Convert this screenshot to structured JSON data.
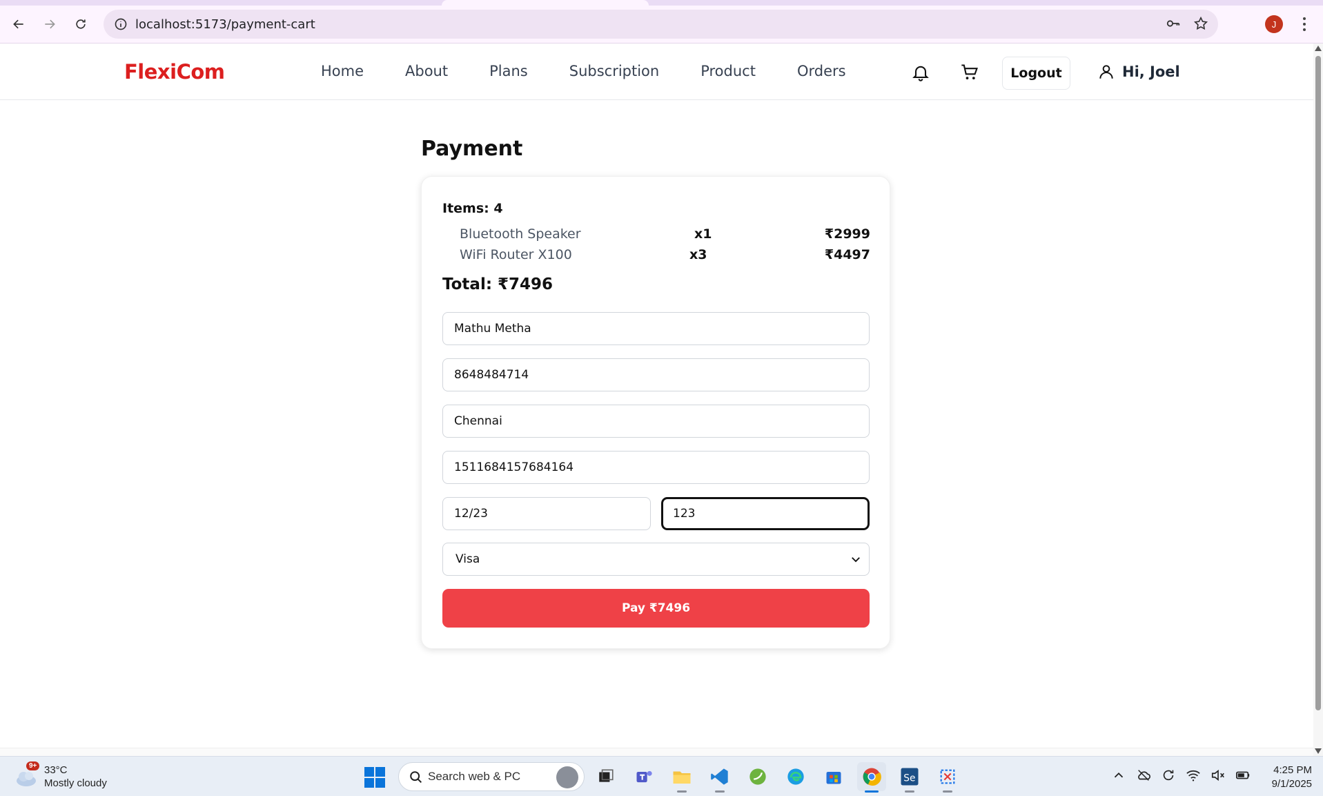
{
  "browser": {
    "url": "localhost:5173/payment-cart",
    "profile_initial": "J"
  },
  "header": {
    "logo": "FlexiCom",
    "nav": [
      "Home",
      "About",
      "Plans",
      "Subscription",
      "Product",
      "Orders"
    ],
    "logout_label": "Logout",
    "greeting": "Hi, Joel",
    "icons": [
      "bell-icon",
      "cart-icon",
      "user-icon"
    ]
  },
  "page": {
    "title": "Payment",
    "items_label": "Items: 4",
    "line_items": [
      {
        "name": "Bluetooth Speaker",
        "qty": "x1",
        "price": "₹2999"
      },
      {
        "name": "WiFi Router X100",
        "qty": "x3",
        "price": "₹4497"
      }
    ],
    "total_label": "Total: ₹7496",
    "form": {
      "name_value": "Mathu Metha",
      "phone_value": "8648484714",
      "city_value": "Chennai",
      "card_number_value": "1511684157684164",
      "expiry_value": "12/23",
      "cvv_value": "123",
      "card_type_value": "Visa"
    },
    "pay_button_label": "Pay ₹7496"
  },
  "taskbar": {
    "weather_temp": "33°C",
    "weather_desc": "Mostly cloudy",
    "weather_badge": "9+",
    "search_placeholder": "Search web & PC",
    "time": "4:25 PM",
    "date": "9/1/2025"
  },
  "colors": {
    "brand": "#dc1f1f",
    "pay_button": "#ef4147"
  }
}
